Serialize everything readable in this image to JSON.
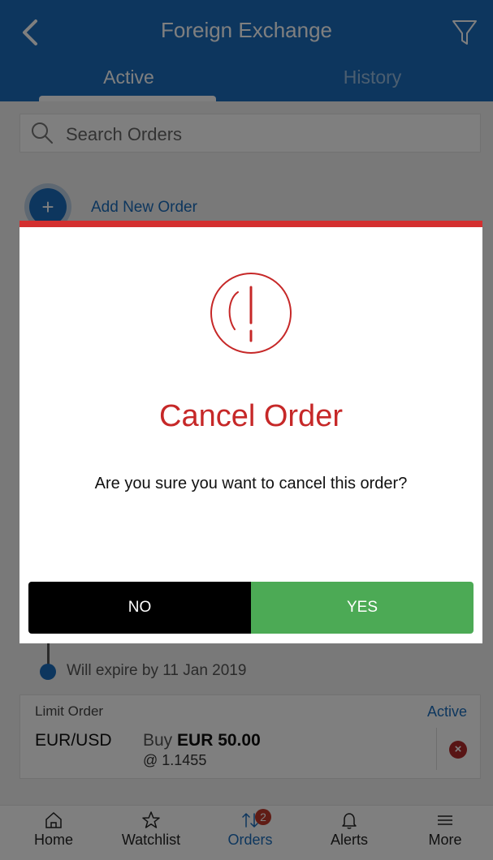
{
  "header": {
    "title": "Foreign Exchange",
    "back_icon": "chevron-left-icon",
    "filter_icon": "filter-icon",
    "tabs": [
      {
        "label": "Active",
        "selected": true
      },
      {
        "label": "History",
        "selected": false
      }
    ]
  },
  "search": {
    "placeholder": "Search Orders",
    "icon": "search-icon"
  },
  "add_order": {
    "icon": "plus",
    "label": "Add New Order"
  },
  "timeline": {
    "expire_text": "Will expire by 11 Jan 2019"
  },
  "order_card": {
    "type": "Limit Order",
    "status": "Active",
    "pair": "EUR/USD",
    "side": "Buy",
    "amount": "EUR 50.00",
    "rate": "@ 1.1455",
    "cancel_icon": "×"
  },
  "modal": {
    "icon": "alert-icon",
    "title": "Cancel Order",
    "message": "Are you sure you want to cancel this order?",
    "no_label": "NO",
    "yes_label": "YES"
  },
  "bottom_nav": {
    "items": [
      {
        "label": "Home",
        "icon": "home-icon"
      },
      {
        "label": "Watchlist",
        "icon": "star-icon"
      },
      {
        "label": "Orders",
        "icon": "transfer-icon",
        "badge": "2",
        "selected": true
      },
      {
        "label": "Alerts",
        "icon": "bell-icon"
      },
      {
        "label": "More",
        "icon": "menu-icon"
      }
    ]
  },
  "colors": {
    "header_blue": "#1a6dbd",
    "alert_red": "#c62828",
    "confirm_green": "#4caa55",
    "cancel_black": "#000000"
  }
}
